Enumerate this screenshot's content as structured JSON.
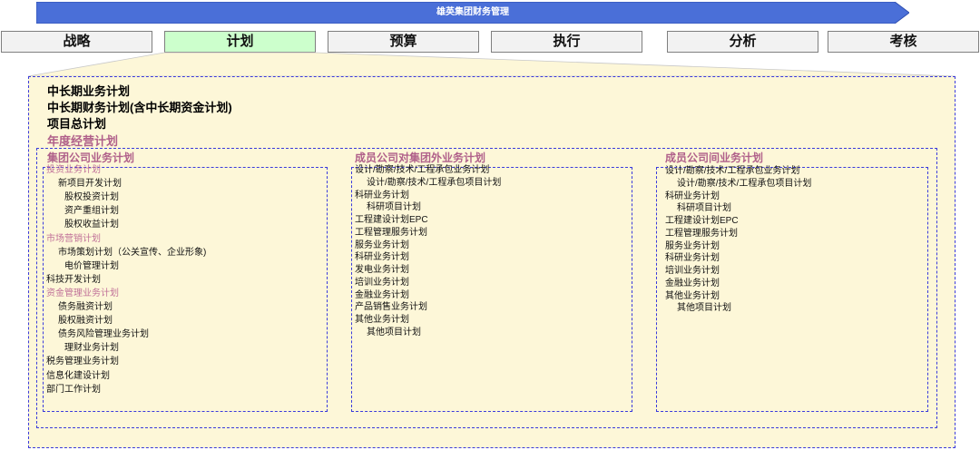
{
  "app_title": "雄英集团财务管理",
  "colors": {
    "banner": "#4a6fd8",
    "active_tab": "#ccffcc",
    "panel": "#fdf7d8",
    "pink_text": "#b0608a",
    "dashed_border": "#3a3adc"
  },
  "tabs": [
    {
      "label": "战略",
      "active": false
    },
    {
      "label": "计划",
      "active": true
    },
    {
      "label": "预算",
      "active": false
    },
    {
      "label": "执行",
      "active": false
    },
    {
      "label": "分析",
      "active": false
    },
    {
      "label": "考核",
      "active": false
    }
  ],
  "plan_items": [
    "中长期业务计划",
    "中长期财务计划(含中长期资金计划)",
    "项目总计划",
    "年度经营计划"
  ],
  "columns": [
    {
      "title": "集团公司业务计划",
      "items": [
        {
          "text": "投资业务计划",
          "indent": 0,
          "highlight": true
        },
        {
          "text": "新项目开发计划",
          "indent": 1
        },
        {
          "text": "股权投资计划",
          "indent": 2
        },
        {
          "text": "资产重组计划",
          "indent": 2
        },
        {
          "text": "股权收益计划",
          "indent": 2
        },
        {
          "text": "市场营销计划",
          "indent": 0,
          "highlight": true
        },
        {
          "text": "市场策划计划（公关宣传、企业形象)",
          "indent": 1
        },
        {
          "text": "电价管理计划",
          "indent": 2
        },
        {
          "text": "科技开发计划",
          "indent": 0
        },
        {
          "text": "资金管理业务计划",
          "indent": 0,
          "highlight": true
        },
        {
          "text": "债务融资计划",
          "indent": 1
        },
        {
          "text": "股权融资计划",
          "indent": 1
        },
        {
          "text": "债务风险管理业务计划",
          "indent": 1
        },
        {
          "text": "理财业务计划",
          "indent": 2
        },
        {
          "text": "税务管理业务计划",
          "indent": 0
        },
        {
          "text": "信息化建设计划",
          "indent": 0
        },
        {
          "text": "部门工作计划",
          "indent": 0
        }
      ]
    },
    {
      "title": "成员公司对集团外业务计划",
      "items": [
        {
          "text": "设计/勘察/技术/工程承包业务计划",
          "indent": 0
        },
        {
          "text": "设计/勘察/技术/工程承包项目计划",
          "indent": 1
        },
        {
          "text": "科研业务计划",
          "indent": 0
        },
        {
          "text": "科研项目计划",
          "indent": 1
        },
        {
          "text": "工程建设计划EPC",
          "indent": 0
        },
        {
          "text": "工程管理服务计划",
          "indent": 0
        },
        {
          "text": "服务业务计划",
          "indent": 0
        },
        {
          "text": "科研业务计划",
          "indent": 0
        },
        {
          "text": "发电业务计划",
          "indent": 0
        },
        {
          "text": "培训业务计划",
          "indent": 0
        },
        {
          "text": "金融业务计划",
          "indent": 0
        },
        {
          "text": "产品销售业务计划",
          "indent": 0
        },
        {
          "text": "其他业务计划",
          "indent": 0
        },
        {
          "text": "其他项目计划",
          "indent": 1
        }
      ]
    },
    {
      "title": "成员公司间业务计划",
      "items": [
        {
          "text": "设计/勘察/技术/工程承包业务计划",
          "indent": 0
        },
        {
          "text": "设计/勘察/技术/工程承包项目计划",
          "indent": 1
        },
        {
          "text": "科研业务计划",
          "indent": 0
        },
        {
          "text": "科研项目计划",
          "indent": 1
        },
        {
          "text": "工程建设计划EPC",
          "indent": 0
        },
        {
          "text": "工程管理服务计划",
          "indent": 0
        },
        {
          "text": "服务业务计划",
          "indent": 0
        },
        {
          "text": "科研业务计划",
          "indent": 0
        },
        {
          "text": "培训业务计划",
          "indent": 0
        },
        {
          "text": "金融业务计划",
          "indent": 0
        },
        {
          "text": "其他业务计划",
          "indent": 0
        },
        {
          "text": "其他项目计划",
          "indent": 1
        }
      ]
    }
  ]
}
